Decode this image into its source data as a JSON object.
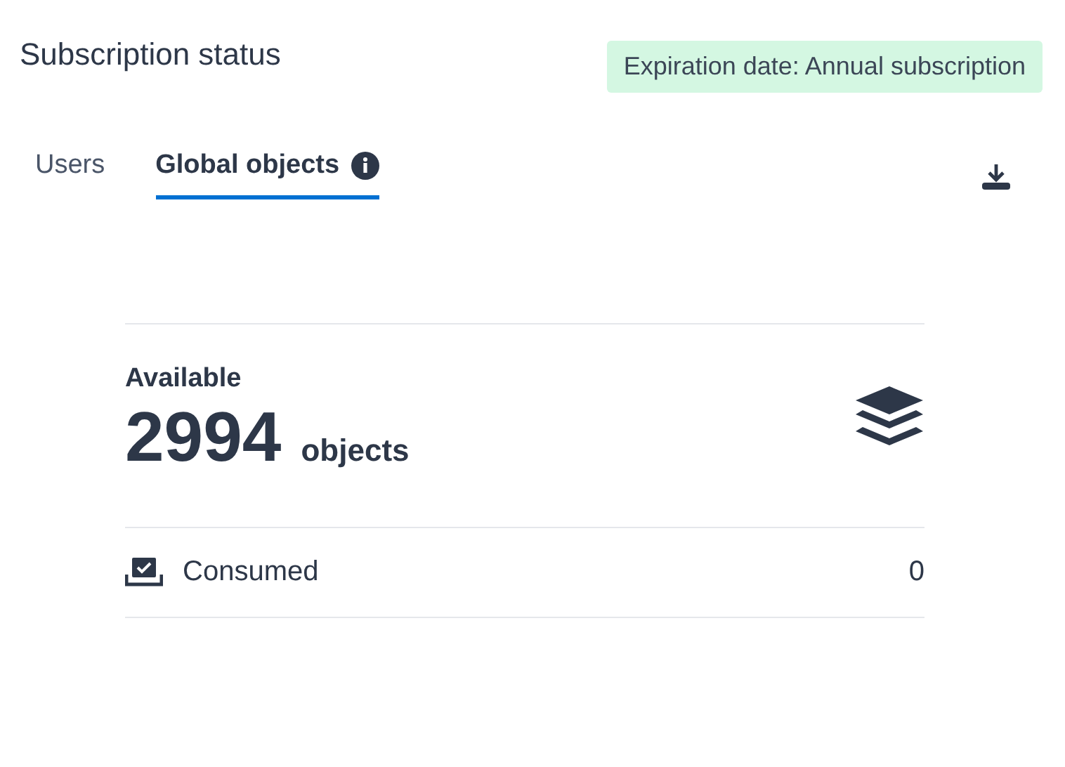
{
  "title": "Subscription status",
  "expiration_badge": "Expiration date: Annual subscription",
  "tabs": [
    {
      "label": "Users",
      "selected": false,
      "info": false
    },
    {
      "label": "Global objects",
      "selected": true,
      "info": true
    }
  ],
  "available": {
    "label": "Available",
    "count": "2994",
    "unit": "objects"
  },
  "consumed": {
    "label": "Consumed",
    "value": "0"
  }
}
